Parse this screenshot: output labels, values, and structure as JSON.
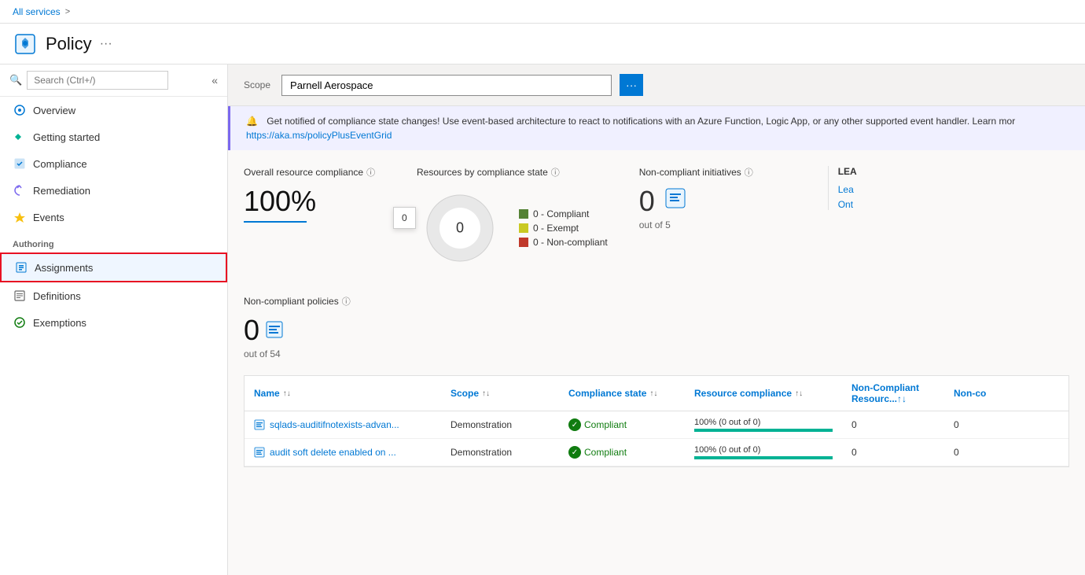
{
  "topbar": {
    "breadcrumb_link": "All services",
    "chevron": ">"
  },
  "header": {
    "title": "Policy",
    "ellipsis": "···"
  },
  "sidebar": {
    "search_placeholder": "Search (Ctrl+/)",
    "collapse_icon": "«",
    "nav_items": [
      {
        "id": "overview",
        "label": "Overview",
        "icon": "overview"
      },
      {
        "id": "getting-started",
        "label": "Getting started",
        "icon": "getting-started"
      },
      {
        "id": "compliance",
        "label": "Compliance",
        "icon": "compliance"
      },
      {
        "id": "remediation",
        "label": "Remediation",
        "icon": "remediation"
      },
      {
        "id": "events",
        "label": "Events",
        "icon": "events"
      }
    ],
    "authoring_label": "Authoring",
    "authoring_items": [
      {
        "id": "assignments",
        "label": "Assignments",
        "icon": "assignments",
        "active": true,
        "highlighted": true
      },
      {
        "id": "definitions",
        "label": "Definitions",
        "icon": "definitions"
      },
      {
        "id": "exemptions",
        "label": "Exemptions",
        "icon": "exemptions"
      }
    ]
  },
  "scope": {
    "label": "Scope",
    "value": "Parnell Aerospace",
    "button_icon": "···"
  },
  "banner": {
    "text": "Get notified of compliance state changes! Use event-based architecture to react to notifications with an Azure Function, Logic App, or any other supported event handler. Learn mor",
    "link": "https://aka.ms/policyPlusEventGrid",
    "link_text": "https://aka.ms/policyPlusEventGrid"
  },
  "stats": {
    "overall_compliance": {
      "title": "Overall resource compliance",
      "value": "100%"
    },
    "resources_by_state": {
      "title": "Resources by compliance state",
      "chart_center": "0",
      "legend": [
        {
          "label": "0 - Compliant",
          "color": "#548235"
        },
        {
          "label": "0 - Exempt",
          "color": "#c9c923"
        },
        {
          "label": "0 - Non-compliant",
          "color": "#c0392b"
        }
      ]
    },
    "non_compliant_initiatives": {
      "title": "Non-compliant initiatives",
      "value": "0",
      "sub": "out of 5"
    },
    "learnmore": {
      "label": "LEA",
      "line1": "Lea",
      "line2": "Ont"
    }
  },
  "policies": {
    "title": "Non-compliant policies",
    "value": "0",
    "sub": "out of 54"
  },
  "table": {
    "columns": [
      {
        "label": "Name"
      },
      {
        "label": "Scope"
      },
      {
        "label": "Compliance state"
      },
      {
        "label": "Resource compliance"
      },
      {
        "label": "Non-Compliant Resourc...↑↓"
      },
      {
        "label": "Non-co"
      }
    ],
    "rows": [
      {
        "name": "sqlads-auditifnotexists-advan...",
        "scope": "Demonstration",
        "compliance_state": "Compliant",
        "resource_compliance_text": "100% (0 out of 0)",
        "resource_compliance_pct": 100,
        "non_compliant": "0",
        "non_co": "0"
      },
      {
        "name": "audit soft delete enabled on ...",
        "scope": "Demonstration",
        "compliance_state": "Compliant",
        "resource_compliance_text": "100% (0 out of 0)",
        "resource_compliance_pct": 100,
        "non_compliant": "0",
        "non_co": "0"
      }
    ]
  }
}
